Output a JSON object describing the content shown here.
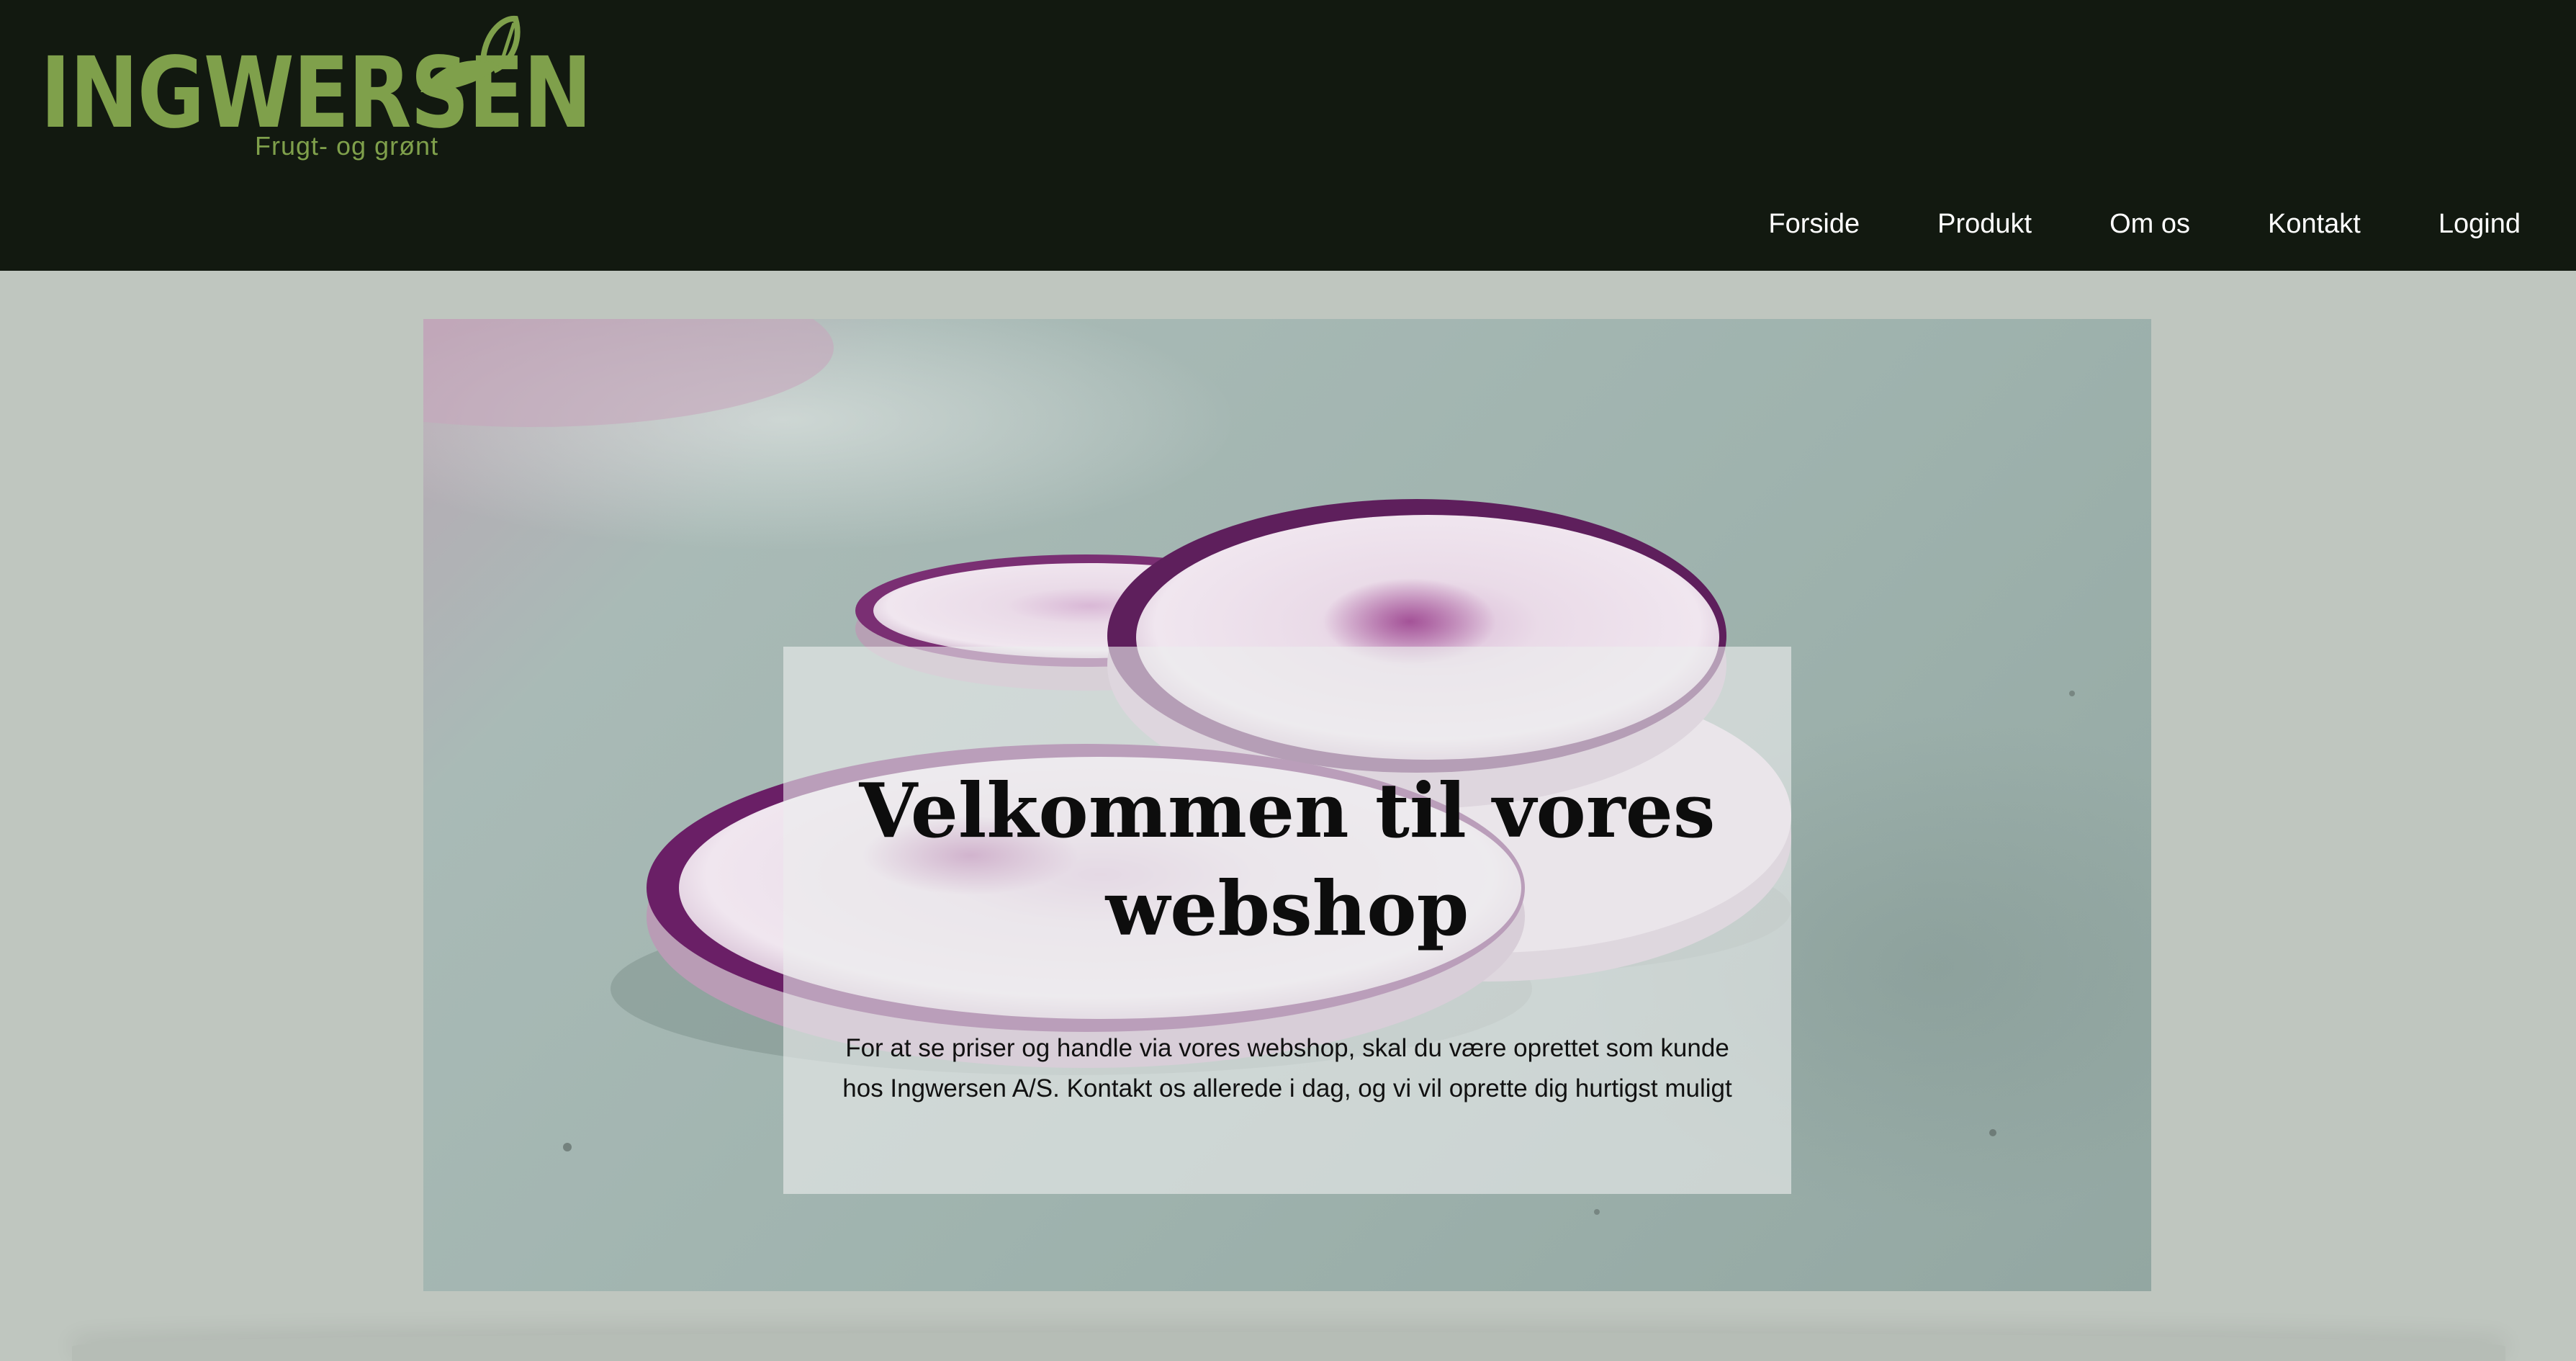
{
  "brand": {
    "name": "INGWERSEN",
    "tagline": "Frugt-  og grønt",
    "color": "#7fa04b"
  },
  "nav": {
    "items": [
      {
        "label": "Forside"
      },
      {
        "label": "Produkt"
      },
      {
        "label": "Om os"
      },
      {
        "label": "Kontakt"
      },
      {
        "label": "Logind"
      }
    ]
  },
  "hero": {
    "image": "sliced purple radish",
    "title": "Velkommen til vores webshop",
    "text": "For at se priser og handle via vores webshop, skal du være oprettet som kunde hos Ingwersen A/S. Kontakt os allerede i dag, og vi vil oprette dig hurtigst muligt"
  },
  "colors": {
    "header_bg": "#121910",
    "page_bg": "#bfc6bf"
  }
}
